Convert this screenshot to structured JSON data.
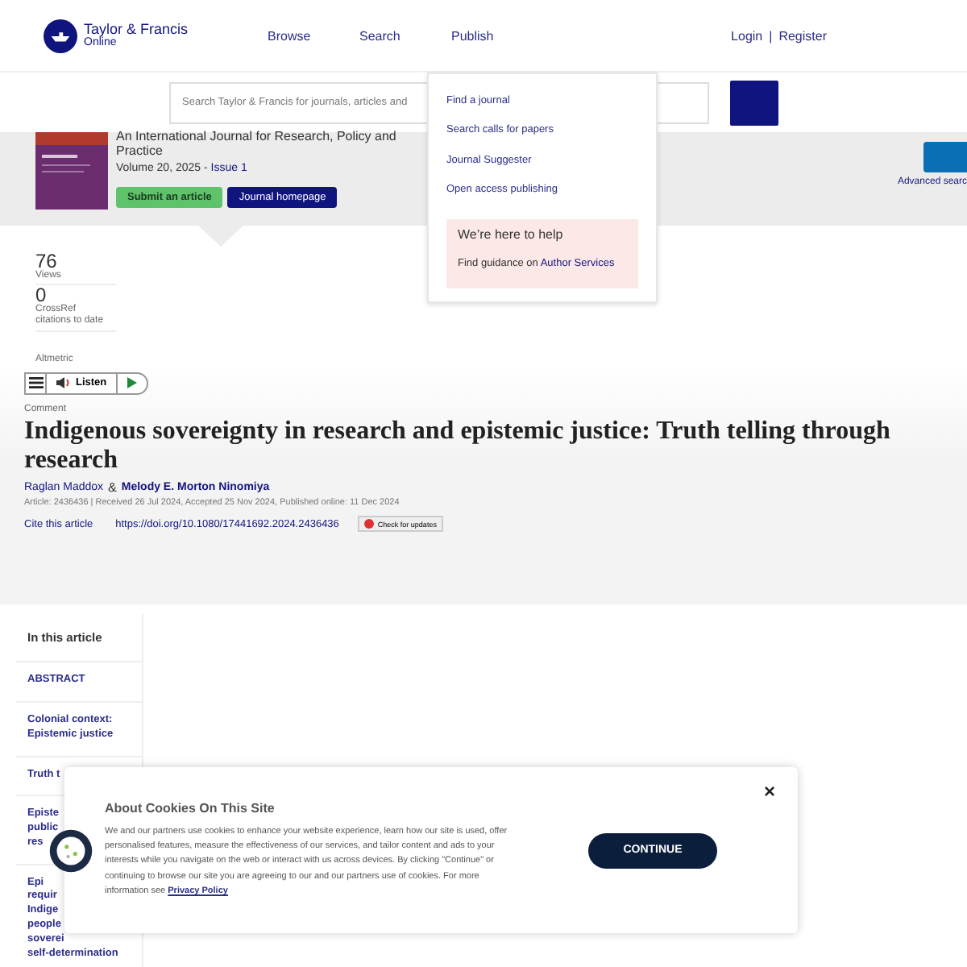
{
  "header": {
    "logo_title": "Taylor & Francis",
    "logo_subtitle": "Online",
    "nav": [
      "Browse",
      "Search",
      "Publish"
    ],
    "login": "Login",
    "separator": "|",
    "register": "Register"
  },
  "search": {
    "placeholder": "Search Taylor & Francis for journals, articles and"
  },
  "publish_menu": {
    "items": [
      "Find a journal",
      "Search calls for papers",
      "Journal Suggester",
      "Open access publishing"
    ],
    "help_title": "We’re here to help",
    "help_text": "Find guidance on ",
    "help_link": "Author Services"
  },
  "journal": {
    "subtitle": "An International Journal for Research, Policy and Practice",
    "volume": "Volume 20, 2025 - ",
    "issue": "Issue 1",
    "buttons": [
      {
        "label": "Submit an article",
        "kind": "green"
      },
      {
        "label": "Journal homepage",
        "kind": "navy"
      }
    ],
    "advanced_search": "Advanced searc"
  },
  "metrics": [
    {
      "value": "76",
      "label": "Views"
    },
    {
      "value": "0",
      "label": "CrossRef citations to date"
    }
  ],
  "altmetric": "Altmetric",
  "listen": {
    "label": "Listen"
  },
  "article": {
    "type": "Comment",
    "title": "Indigenous sovereignty in research and epistemic justice: Truth telling through research",
    "authors": [
      {
        "name": "Raglan Maddox",
        "bold": false
      },
      {
        "name": "Melody E. Morton Ninomiya",
        "bold": true
      }
    ],
    "author_sep": "&",
    "meta": "Article: 2436436 | Received 26 Jul 2024, Accepted 25 Nov 2024, Published online: 11 Dec 2024",
    "cite": "Cite this article",
    "doi": "https://doi.org/10.1080/17441692.2024.2436436",
    "updates": "Check for updates"
  },
  "toc": {
    "title": "In this article",
    "items": [
      [
        "ABSTRACT"
      ],
      [
        "Colonial context:",
        "Epistemic justice"
      ],
      [
        "Truth t"
      ],
      [
        "Episte",
        "public",
        "res"
      ],
      [
        "Epi",
        "requir",
        "Indige",
        "people",
        "soverei",
        "self-determination"
      ]
    ]
  },
  "cookie": {
    "title": "About Cookies On This Site",
    "text": "We and our partners use cookies to enhance your website experience, learn how our site is used, offer personalised features, measure the effectiveness of our services, and tailor content and ads to your interests while you navigate on the web or interact with us across devices. By clicking \"Continue\" or continuing to browse our site you are agreeing to our and our partners use of cookies. For more information see ",
    "link": "Privacy Policy",
    "button": "CONTINUE",
    "close": "×"
  }
}
